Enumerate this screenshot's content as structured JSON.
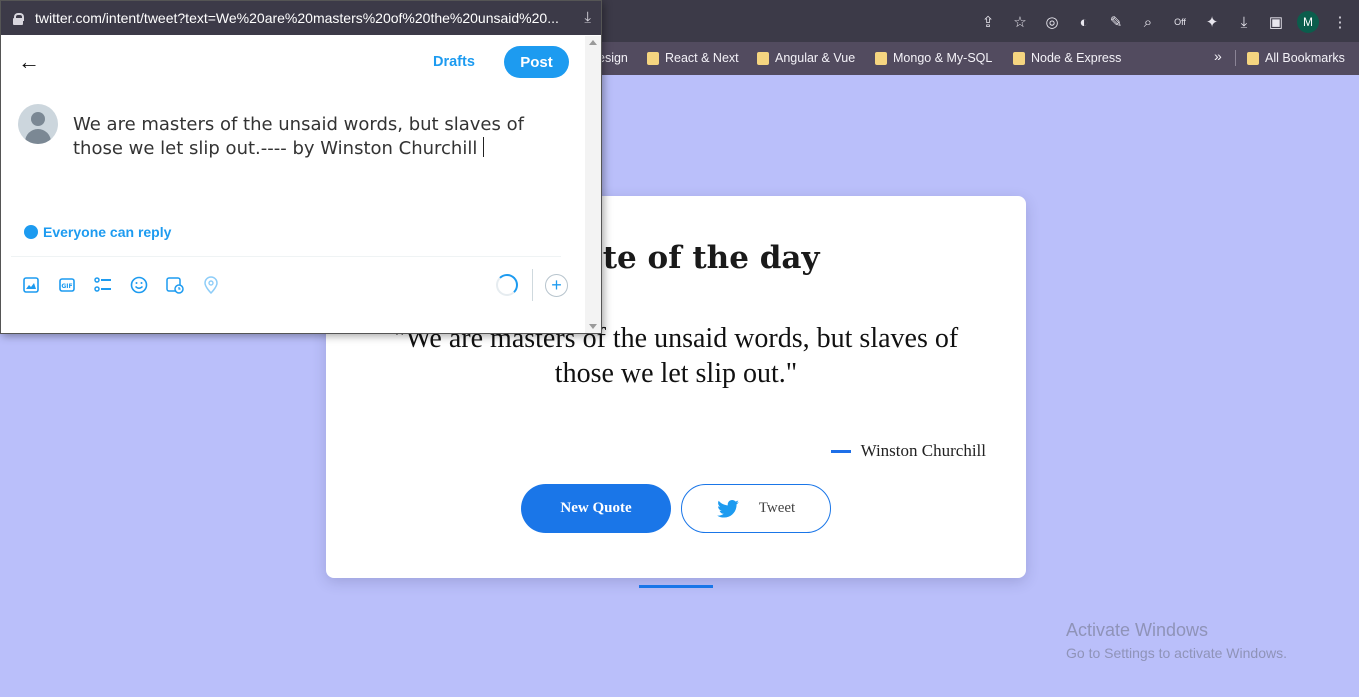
{
  "browser": {
    "bookmarks": [
      {
        "label": "esign"
      },
      {
        "label": "React & Next"
      },
      {
        "label": "Angular & Vue"
      },
      {
        "label": "Mongo & My-SQL"
      },
      {
        "label": "Node & Express"
      }
    ],
    "more": "»",
    "all_bookmarks": "All Bookmarks",
    "profile_initial": "M",
    "extension_badge": "Off"
  },
  "popup": {
    "url": "twitter.com/intent/tweet?text=We%20are%20masters%20of%20the%20unsaid%20...",
    "drafts_label": "Drafts",
    "post_label": "Post",
    "tweet_text_line1": "We are masters of the unsaid words, but slaves of",
    "tweet_text_line2": "those we let slip out.---- by Winston Churchill",
    "reply_setting": "Everyone can reply"
  },
  "card": {
    "title": "Quote of the day",
    "quote_line1": "\"We are masters of the unsaid words, but slaves of",
    "quote_line2": "those we let slip out.\"",
    "author": "Winston Churchill",
    "new_quote_label": "New Quote",
    "tweet_label": "Tweet"
  },
  "watermark": {
    "line1": "Activate Windows",
    "line2": "Go to Settings to activate Windows."
  },
  "colors": {
    "accent": "#1a76e8",
    "twitter_blue": "#1d9bf0",
    "page_bg": "#babffa"
  }
}
